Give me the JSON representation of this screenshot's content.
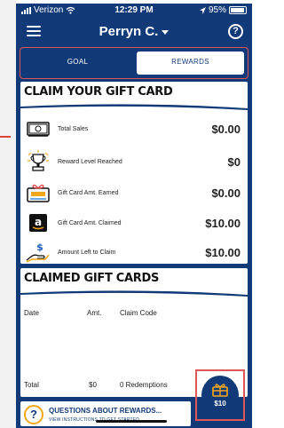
{
  "status_bar": {
    "carrier": "Verizon",
    "time": "12:29 PM",
    "battery": "95%"
  },
  "nav": {
    "title": "Perryn C."
  },
  "tabs": [
    {
      "label": "GOAL"
    },
    {
      "label": "REWARDS"
    }
  ],
  "claim_card": {
    "title": "CLAIM YOUR GIFT CARD",
    "rows": [
      {
        "label": "Total Sales",
        "value": "$0.00",
        "icon": "cash-icon"
      },
      {
        "label": "Reward Level Reached",
        "value": "$0",
        "icon": "trophy-icon"
      },
      {
        "label": "Gift Card Amt. Earned",
        "value": "$0.00",
        "icon": "gift-card-icon"
      },
      {
        "label": "Gift Card Amt. Claimed",
        "value": "$10.00",
        "icon": "amazon-icon"
      },
      {
        "label": "Amount Left to Claim",
        "value": "$10.00",
        "icon": "hand-dollar-icon"
      }
    ]
  },
  "claimed_card": {
    "title": "CLAIMED GIFT CARDS",
    "columns": [
      "Date",
      "Amt.",
      "Claim Code"
    ],
    "totals": {
      "label": "Total",
      "amount": "$0",
      "redemptions": "0 Redemptions"
    }
  },
  "fab": {
    "amount": "$10"
  },
  "questions": {
    "title": "QUESTIONS ABOUT REWARDS...",
    "subtitle": "VIEW INSTRUCTIONS TO GET STARTED"
  },
  "colors": {
    "navy": "#123a78",
    "accent_red": "#e05555",
    "orange": "#f2a71b"
  }
}
